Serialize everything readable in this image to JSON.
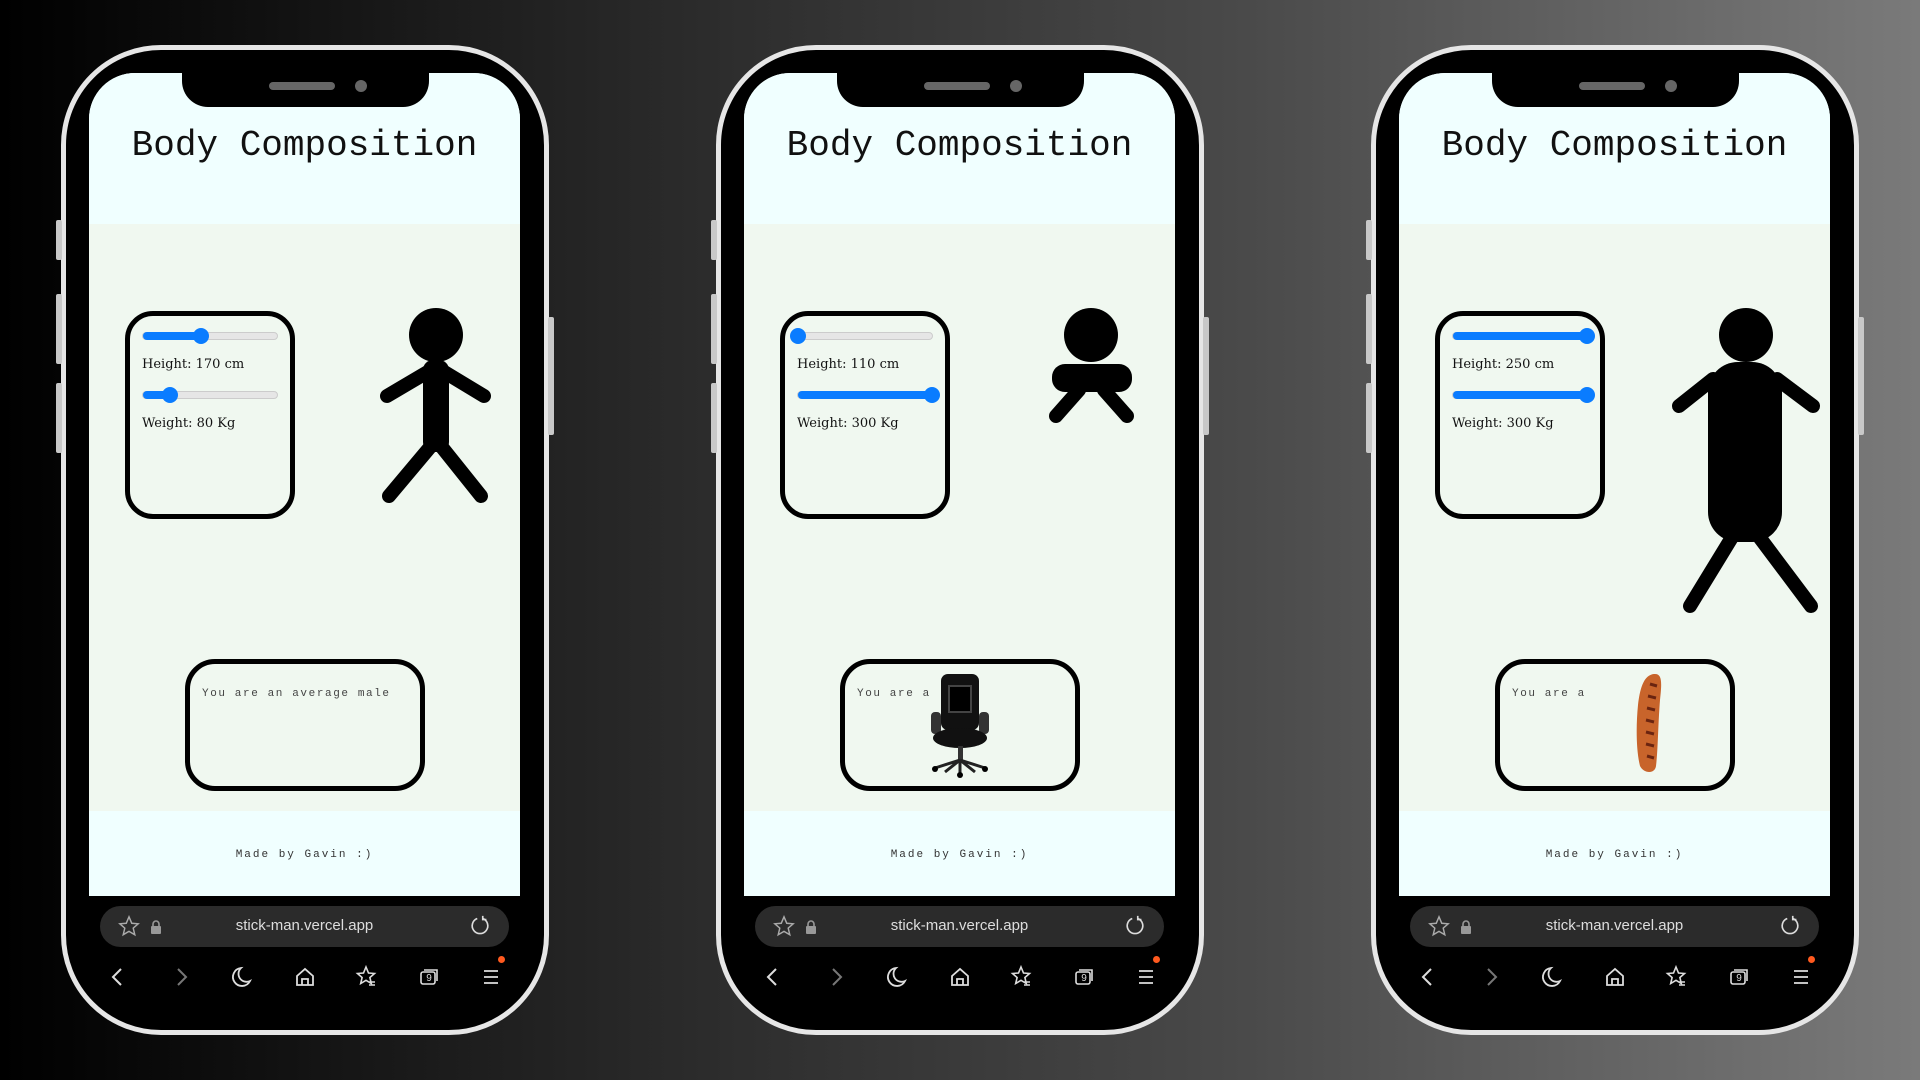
{
  "colors": {
    "accent": "#0a7cff",
    "header_bg": "#f0ffff",
    "main_bg": "#f0f8f0",
    "badge": "#ff5a1f"
  },
  "phones": [
    {
      "title": "Body Composition",
      "height_label": "Height: 170 cm",
      "weight_label": "Weight: 80 Kg",
      "height_fraction": 0.43,
      "weight_fraction": 0.2,
      "figure": "average",
      "result_text": "You are an average male",
      "result_image": "",
      "footer": "Made by Gavin :)",
      "url": "stick-man.vercel.app",
      "tabs_count": "9"
    },
    {
      "title": "Body Composition",
      "height_label": "Height: 110 cm",
      "weight_label": "Weight: 300 Kg",
      "height_fraction": 0.0,
      "weight_fraction": 1.0,
      "figure": "short-wide",
      "result_text": "You are a",
      "result_image": "office-chair",
      "footer": "Made by Gavin :)",
      "url": "stick-man.vercel.app",
      "tabs_count": "9"
    },
    {
      "title": "Body Composition",
      "height_label": "Height: 250 cm",
      "weight_label": "Weight: 300 Kg",
      "height_fraction": 1.0,
      "weight_fraction": 1.0,
      "figure": "tall-wide",
      "result_text": "You are a",
      "result_image": "sausage",
      "footer": "Made by Gavin :)",
      "url": "stick-man.vercel.app",
      "tabs_count": "9"
    }
  ]
}
